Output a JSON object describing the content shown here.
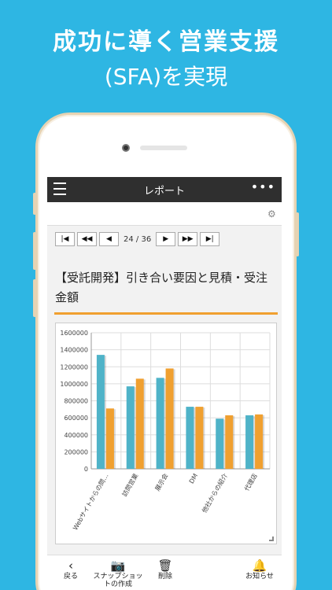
{
  "promo": {
    "line1": "成功に導く営業支援",
    "line2": "(SFA)を実現"
  },
  "app": {
    "title": "レポート",
    "more": "•••"
  },
  "pager": {
    "first": "|◀",
    "prev_fast": "◀◀",
    "prev": "◀",
    "count": "24 / 36",
    "next": "▶",
    "next_fast": "▶▶",
    "last": "▶|"
  },
  "report": {
    "title": "【受託開発】引き合い要因と見積・受注金額"
  },
  "tabs": [
    {
      "label": "戻る",
      "icon": "chevron-left-icon",
      "glyph": "‹"
    },
    {
      "label": "スナップショットの作成",
      "icon": "snapshot-icon",
      "glyph": "📷"
    },
    {
      "label": "削除",
      "icon": "trash-icon",
      "glyph": "🗑"
    },
    {
      "label": "お知らせ",
      "icon": "bell-icon",
      "glyph": "🔔"
    }
  ],
  "colors": {
    "series1": "#4fb3c8",
    "series2": "#f0a030",
    "accent": "#2eb6e3"
  },
  "chart_data": {
    "type": "bar",
    "categories": [
      "Webサイトからの問…",
      "訪問営業",
      "展示会",
      "DM",
      "他社からの紹介",
      "代理店"
    ],
    "series": [
      {
        "values": [
          1340000,
          970000,
          1070000,
          730000,
          590000,
          630000
        ]
      },
      {
        "values": [
          710000,
          1060000,
          1180000,
          730000,
          630000,
          640000
        ]
      }
    ],
    "yticks": [
      "1600000",
      "1400000",
      "1200000",
      "1000000",
      "800000",
      "600000",
      "400000",
      "200000",
      "0"
    ],
    "ylim": [
      0,
      1600000
    ],
    "grid": true
  }
}
